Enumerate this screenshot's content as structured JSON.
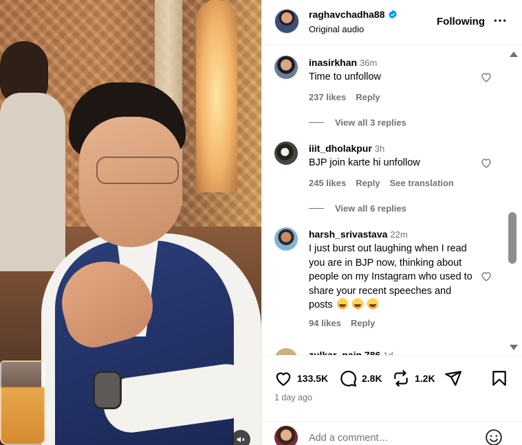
{
  "post": {
    "username": "raghavchadha88",
    "audio_label": "Original audio",
    "follow_label": "Following"
  },
  "comments": [
    {
      "username": "inasirkhan",
      "time": "36m",
      "text": "Time to unfollow",
      "likes": "237 likes",
      "reply_label": "Reply",
      "view_replies": "View all 3 replies",
      "avatar_color": "#6b7d92"
    },
    {
      "username": "iiit_dholakpur",
      "time": "3h",
      "text": "BJP join karte hi unfollow",
      "likes": "245 likes",
      "reply_label": "Reply",
      "translation_label": "See translation",
      "view_replies": "View all 6 replies",
      "avatar_color": "#3e4a3a"
    },
    {
      "username": "harsh_srivastava",
      "time": "22m",
      "text": "I just burst out laughing when I read you are in BJP now, thinking about people on my Instagram who used to share your recent speeches and posts",
      "likes": "94 likes",
      "reply_label": "Reply",
      "avatar_color": "#7fb4d6"
    },
    {
      "username": "zulkar_nain.786",
      "time": "1d",
      "avatar_color": "#c9b27a"
    }
  ],
  "actions": {
    "likes_count": "133.5K",
    "comments_count": "2.8K",
    "reposts_count": "1.2K"
  },
  "posted_ago": "1 day ago",
  "add_comment": {
    "placeholder": "Add a comment…"
  },
  "colors": {
    "verified_blue": "#0095f6",
    "secondary_text": "#737373"
  }
}
